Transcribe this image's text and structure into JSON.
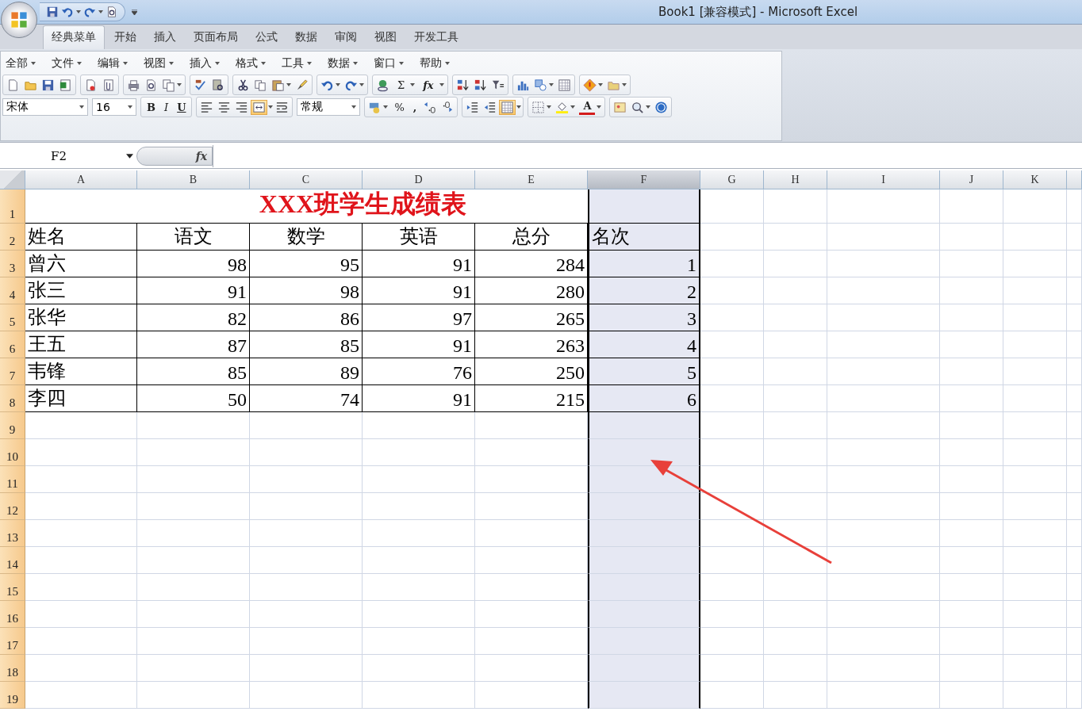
{
  "window": {
    "title": "Book1  [兼容模式] - Microsoft Excel"
  },
  "ribbon_tabs": [
    {
      "label": "经典菜单",
      "selected": true
    },
    {
      "label": "开始",
      "selected": false
    },
    {
      "label": "插入",
      "selected": false
    },
    {
      "label": "页面布局",
      "selected": false
    },
    {
      "label": "公式",
      "selected": false
    },
    {
      "label": "数据",
      "selected": false
    },
    {
      "label": "审阅",
      "selected": false
    },
    {
      "label": "视图",
      "selected": false
    },
    {
      "label": "开发工具",
      "selected": false
    }
  ],
  "menus": [
    "全部",
    "文件",
    "编辑",
    "视图",
    "插入",
    "格式",
    "工具",
    "数据",
    "窗口",
    "帮助"
  ],
  "toolbar": {
    "sum": "Σ",
    "function": "fx",
    "bold": "B",
    "italic": "I",
    "underline": "U",
    "percent": "%",
    "comma": ",",
    "font_color": "A",
    "font": "宋体",
    "font_size": "16",
    "number_format": "常规",
    "merge_center_on": true,
    "align_box_on": true
  },
  "formula_bar": {
    "name_box": "F2",
    "function": "fx"
  },
  "columns": [
    {
      "label": "A",
      "selected": false
    },
    {
      "label": "B",
      "selected": false
    },
    {
      "label": "C",
      "selected": false
    },
    {
      "label": "D",
      "selected": false
    },
    {
      "label": "E",
      "selected": false
    },
    {
      "label": "F",
      "selected": true
    },
    {
      "label": "G",
      "selected": false
    },
    {
      "label": "H",
      "selected": false
    },
    {
      "label": "I",
      "selected": false
    },
    {
      "label": "J",
      "selected": false
    },
    {
      "label": "K",
      "selected": false
    }
  ],
  "sheet_title": {
    "row": "1",
    "text": "XXX班学生成绩表"
  },
  "rows": [
    {
      "header": "2",
      "kind": "heading",
      "cells": [
        "姓名",
        "语文",
        "数学",
        "英语",
        "总分",
        "名次"
      ]
    },
    {
      "header": "3",
      "kind": "data",
      "cells": [
        "曾六",
        "98",
        "95",
        "91",
        "284",
        "1"
      ]
    },
    {
      "header": "4",
      "kind": "data",
      "cells": [
        "张三",
        "91",
        "98",
        "91",
        "280",
        "2"
      ]
    },
    {
      "header": "5",
      "kind": "data",
      "cells": [
        "张华",
        "82",
        "86",
        "97",
        "265",
        "3"
      ]
    },
    {
      "header": "6",
      "kind": "data",
      "cells": [
        "王五",
        "87",
        "85",
        "91",
        "263",
        "4"
      ]
    },
    {
      "header": "7",
      "kind": "data",
      "cells": [
        "韦锋",
        "85",
        "89",
        "76",
        "250",
        "5"
      ]
    },
    {
      "header": "8",
      "kind": "data",
      "cells": [
        "李四",
        "50",
        "74",
        "91",
        "215",
        "6"
      ]
    },
    {
      "header": "9",
      "kind": "empty",
      "cells": []
    },
    {
      "header": "10",
      "kind": "empty",
      "cells": []
    },
    {
      "header": "11",
      "kind": "empty",
      "cells": []
    },
    {
      "header": "12",
      "kind": "empty",
      "cells": []
    },
    {
      "header": "13",
      "kind": "empty",
      "cells": []
    },
    {
      "header": "14",
      "kind": "empty",
      "cells": []
    },
    {
      "header": "15",
      "kind": "empty",
      "cells": []
    },
    {
      "header": "16",
      "kind": "empty",
      "cells": []
    },
    {
      "header": "17",
      "kind": "empty",
      "cells": []
    },
    {
      "header": "18",
      "kind": "empty",
      "cells": []
    },
    {
      "header": "19",
      "kind": "empty",
      "cells": []
    }
  ]
}
